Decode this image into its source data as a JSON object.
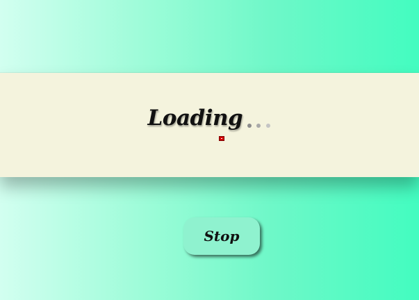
{
  "loader": {
    "title": "Loading",
    "dots": [
      "dot",
      "dot",
      "dot"
    ],
    "indicator_icon": "stop-square-icon",
    "indicator_color": "#d40000"
  },
  "controls": {
    "stop_label": "Stop"
  },
  "colors": {
    "banner_background": "#f4f3dd",
    "gradient_start": "#d2fff0",
    "gradient_end": "#43fcc0",
    "button_background": "#8ff2cf"
  }
}
